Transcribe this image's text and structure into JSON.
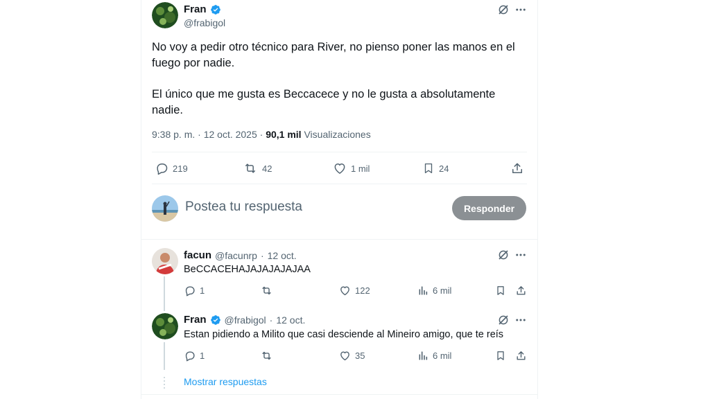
{
  "main_tweet": {
    "name": "Fran",
    "handle": "@frabigol",
    "text_p1": "No voy a pedir otro técnico para River, no pienso poner las manos en el fuego por nadie.",
    "text_p2": "El único que me gusta es Beccacece y no le gusta a absolutamente nadie.",
    "time": "9:38 p. m. · 12 oct. 2025 · ",
    "views_count": "90,1 mil",
    "views_label": " Visualizaciones",
    "replies": "219",
    "reposts": "42",
    "likes": "1 mil",
    "bookmarks": "24"
  },
  "composer": {
    "placeholder": "Postea tu respuesta",
    "button": "Responder"
  },
  "replies": [
    {
      "name": "facun",
      "handle": "@facunrp",
      "date": "12 oct.",
      "text": "BeCCACEHAJAJAJAJAJAA",
      "replies": "1",
      "reposts": "",
      "likes": "122",
      "views": "6 mil"
    },
    {
      "name": "Fran",
      "handle": "@frabigol",
      "date": "12 oct.",
      "text": "Estan pidiendo a Milito que casi desciende al Mineiro amigo, que te reís",
      "replies": "1",
      "reposts": "",
      "likes": "35",
      "views": "6 mil"
    }
  ],
  "show_replies": "Mostrar respuestas",
  "colors": {
    "accent": "#1d9bf0",
    "muted": "#536471",
    "button": "#8b9094"
  }
}
